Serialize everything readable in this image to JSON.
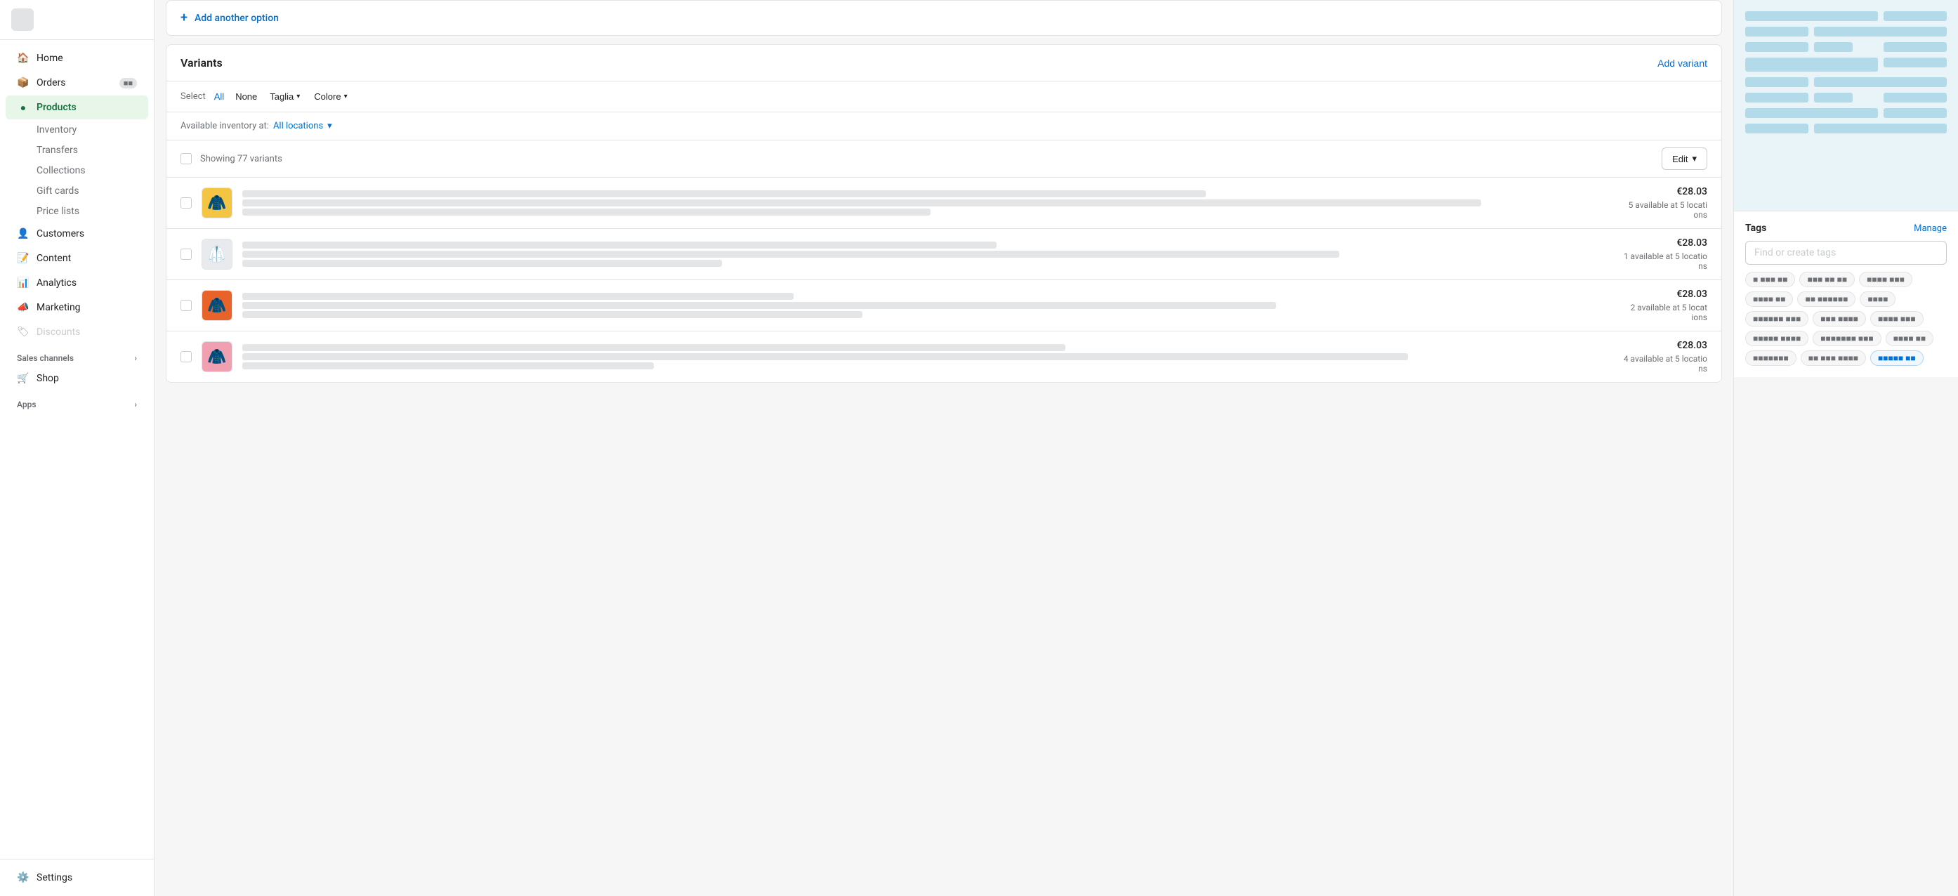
{
  "sidebar": {
    "items": [
      {
        "id": "home",
        "label": "Home",
        "icon": "🏠",
        "active": false,
        "level": 0
      },
      {
        "id": "orders",
        "label": "Orders",
        "icon": "📦",
        "active": false,
        "level": 0,
        "badge": "••"
      },
      {
        "id": "products",
        "label": "Products",
        "icon": "🏷️",
        "active": true,
        "level": 0
      },
      {
        "id": "inventory",
        "label": "Inventory",
        "icon": "",
        "active": false,
        "level": 1
      },
      {
        "id": "transfers",
        "label": "Transfers",
        "icon": "",
        "active": false,
        "level": 1
      },
      {
        "id": "collections",
        "label": "Collections",
        "icon": "",
        "active": false,
        "level": 1
      },
      {
        "id": "gift-cards",
        "label": "Gift cards",
        "icon": "",
        "active": false,
        "level": 1
      },
      {
        "id": "price-lists",
        "label": "Price lists",
        "icon": "",
        "active": false,
        "level": 1
      },
      {
        "id": "customers",
        "label": "Customers",
        "icon": "👤",
        "active": false,
        "level": 0
      },
      {
        "id": "content",
        "label": "Content",
        "icon": "📝",
        "active": false,
        "level": 0
      },
      {
        "id": "analytics",
        "label": "Analytics",
        "icon": "📊",
        "active": false,
        "level": 0
      },
      {
        "id": "marketing",
        "label": "Marketing",
        "icon": "📣",
        "active": false,
        "level": 0
      },
      {
        "id": "discounts",
        "label": "Discounts",
        "icon": "🏷",
        "active": false,
        "level": 0
      }
    ],
    "sections": [
      {
        "id": "sales-channels",
        "label": "Sales channels",
        "expandable": true
      },
      {
        "id": "shop",
        "label": "Shop",
        "icon": "🛒"
      },
      {
        "id": "apps",
        "label": "Apps",
        "expandable": true
      }
    ],
    "settings": {
      "label": "Settings",
      "icon": "⚙️"
    }
  },
  "add_option": {
    "label": "Add another option"
  },
  "variants": {
    "title": "Variants",
    "add_variant_label": "Add variant",
    "filter": {
      "select_label": "Select",
      "all_label": "All",
      "none_label": "None",
      "taglia_label": "Taglia",
      "colore_label": "Colore"
    },
    "inventory_label": "Available inventory at:",
    "all_locations_label": "All locations",
    "showing_label": "Showing 77 variants",
    "edit_label": "Edit",
    "rows": [
      {
        "id": 1,
        "thumb_color": "yellow",
        "price": "€28.03",
        "stock": "5 available at 5 locations",
        "thumb_emoji": "🧥"
      },
      {
        "id": 2,
        "thumb_color": "white",
        "price": "€28.03",
        "stock": "1 available at 5 locations",
        "thumb_emoji": "🥼"
      },
      {
        "id": 3,
        "thumb_color": "orange",
        "price": "€28.03",
        "stock": "2 available at 5 locations",
        "thumb_emoji": "🧥"
      },
      {
        "id": 4,
        "thumb_color": "pink",
        "price": "€28.03",
        "stock": "4 available at 5 locations",
        "thumb_emoji": "🧥"
      }
    ]
  },
  "tags": {
    "title": "Tags",
    "manage_label": "Manage",
    "input_placeholder": "Find or create tags",
    "chips": [
      "tag one",
      "tag two ••",
      "tag three",
      "another tag",
      "long tag name ••",
      "short",
      "medium tag",
      "tag item",
      "extra ••",
      "more tags",
      "tag label",
      "item tag",
      "category",
      "group tag",
      "blue-tag"
    ]
  }
}
